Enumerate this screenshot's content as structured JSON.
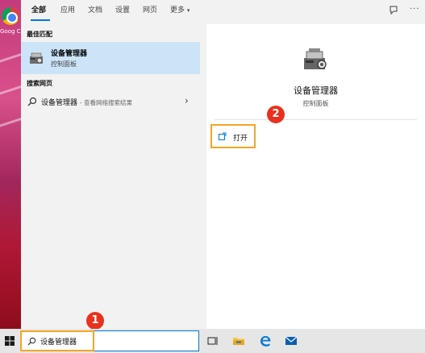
{
  "desktop": {
    "icon_name": "chrome-icon",
    "label": "Goog Chrom"
  },
  "tabs": [
    {
      "label": "全部",
      "active": true
    },
    {
      "label": "应用",
      "active": false
    },
    {
      "label": "文档",
      "active": false
    },
    {
      "label": "设置",
      "active": false
    },
    {
      "label": "网页",
      "active": false
    },
    {
      "label": "更多",
      "active": false
    }
  ],
  "best_match": {
    "section_title": "最佳匹配",
    "title": "设备管理器",
    "subtitle": "控制面板",
    "icon_name": "device-manager-icon"
  },
  "web_search": {
    "section_title": "搜索网页",
    "query": "设备管理器",
    "hint": "- 查看网络搜索结果"
  },
  "detail": {
    "title": "设备管理器",
    "subtitle": "控制面板",
    "open_label": "打开"
  },
  "badges": {
    "step1": "1",
    "step2": "2"
  },
  "taskbar": {
    "search_value": "设备管理器",
    "icons": [
      "task-view-icon",
      "file-explorer-icon",
      "edge-icon",
      "mail-icon"
    ]
  },
  "colors": {
    "accent": "#0078d7",
    "selection": "#cce4f7",
    "highlight_box": "#f5a623",
    "badge": "#e8321e"
  }
}
